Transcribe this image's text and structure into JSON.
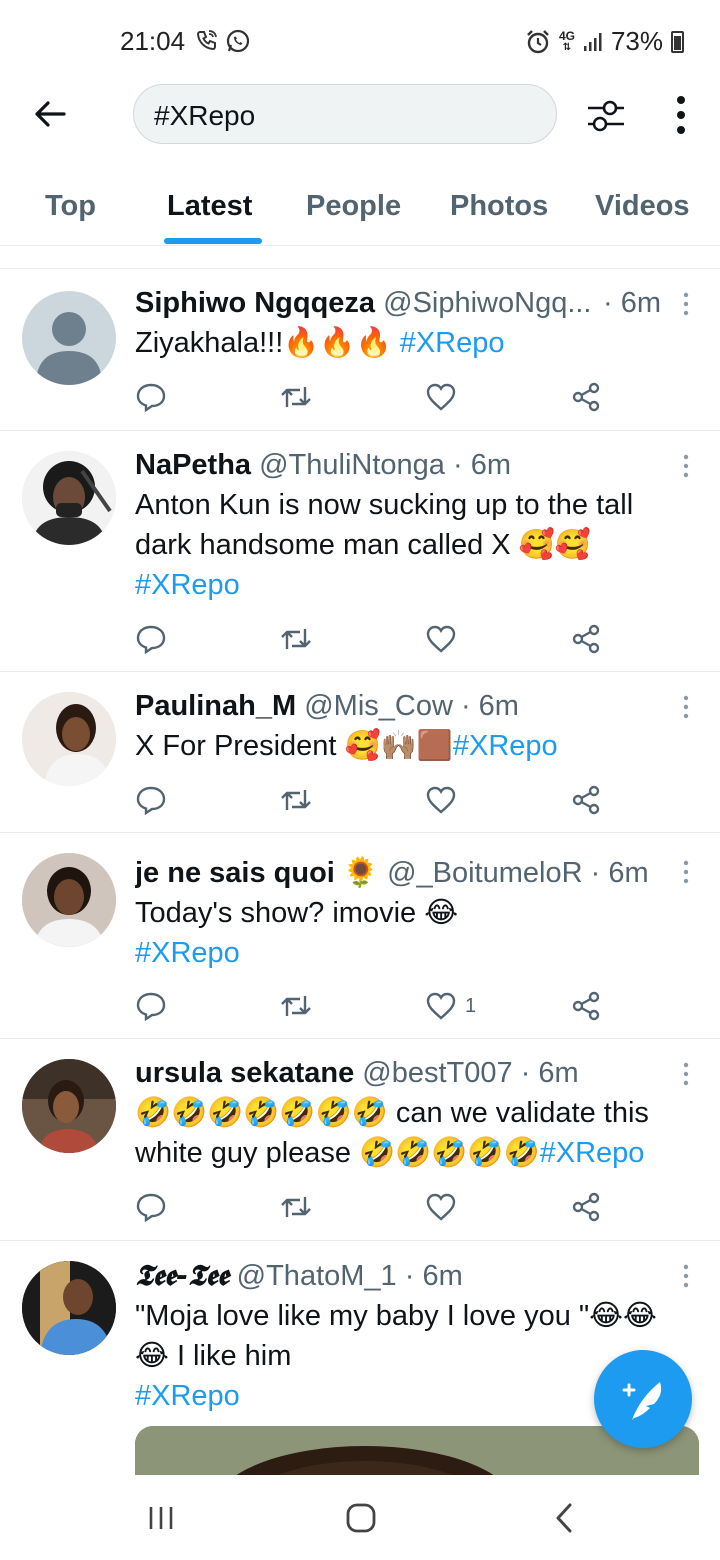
{
  "status": {
    "time": "21:04",
    "network": "4G",
    "battery": "73%"
  },
  "search": {
    "query": "#XRepo"
  },
  "tabs": [
    {
      "label": "Top"
    },
    {
      "label": "Latest"
    },
    {
      "label": "People"
    },
    {
      "label": "Photos"
    },
    {
      "label": "Videos"
    }
  ],
  "tweets": [
    {
      "name": "Siphiwo Ngqqeza",
      "meta": "@SiphiwoNgq...",
      "time": "· 6m",
      "text": "Ziyakhala!!!🔥🔥🔥",
      "hashtag": "#XRepo",
      "like_count": ""
    },
    {
      "name": "NaPetha",
      "meta": "@ThuliNtonga",
      "time": "· 6m",
      "text": "Anton Kun is now sucking up to the tall dark handsome man called X 🥰🥰",
      "hashtag": "#XRepo",
      "like_count": ""
    },
    {
      "name": "Paulinah_M",
      "meta": "@Mis_Cow",
      "time": "· 6m",
      "text": "X For President 🥰🙌🏽🟫",
      "hashtag": "#XRepo",
      "like_count": ""
    },
    {
      "name": "je ne sais quoi 🌻",
      "meta": "@_BoitumeloR",
      "time": "· 6m",
      "text": "Today's show? imovie 😂",
      "hashtag": "#XRepo",
      "like_count": "1"
    },
    {
      "name": "ursula sekatane",
      "meta": "@bestT007",
      "time": "· 6m",
      "text": "🤣🤣🤣🤣🤣🤣🤣 can we validate this white guy please 🤣🤣🤣🤣🤣",
      "hashtag": "#XRepo",
      "like_count": ""
    },
    {
      "name": "𝕿𝖊𝖊-𝕿𝖊𝖊",
      "meta": "@ThatoM_1",
      "time": "· 6m",
      "text": "\"Moja love like my baby I love you \"😂😂😂 I like him",
      "hashtag": "#XRepo",
      "like_count": ""
    }
  ],
  "colors": {
    "accent": "#1d9bf0",
    "text_primary": "#0f1419",
    "text_secondary": "#536471",
    "divider": "#e6ecf0"
  },
  "icons": {
    "back": "arrow-left-icon",
    "filter": "sliders-icon",
    "more": "vertical-dots-icon",
    "reply": "speech-bubble-icon",
    "retweet": "retweet-icon",
    "like": "heart-icon",
    "share": "share-icon",
    "compose": "feather-plus-icon"
  }
}
